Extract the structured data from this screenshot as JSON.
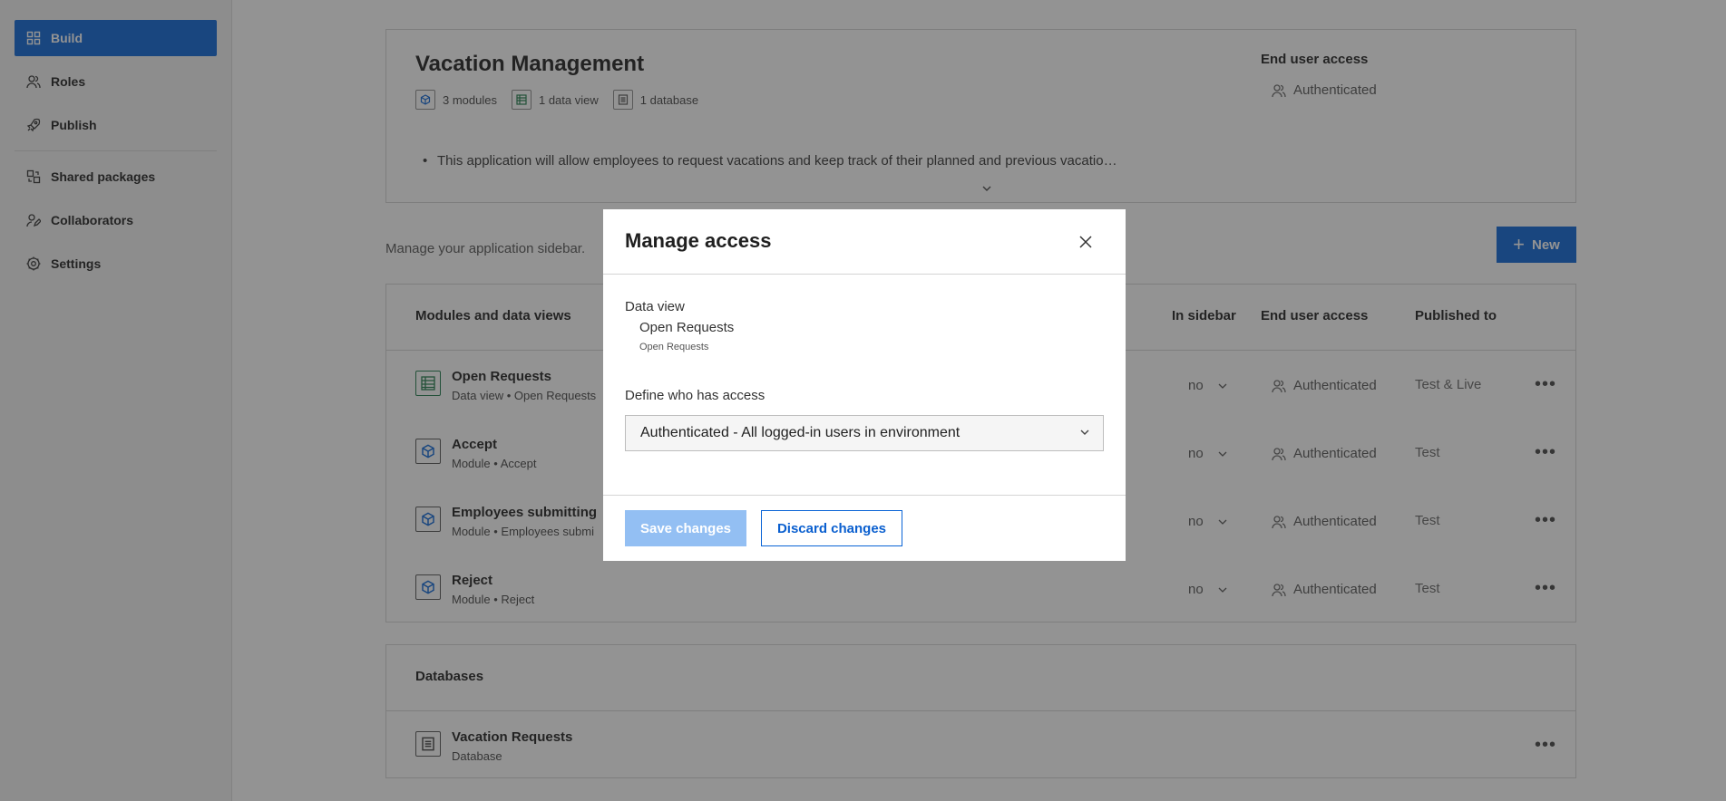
{
  "nav": {
    "items": [
      {
        "label": "Build",
        "icon": "grid-icon"
      },
      {
        "label": "Roles",
        "icon": "users-icon"
      },
      {
        "label": "Publish",
        "icon": "rocket-icon"
      },
      {
        "label": "Shared packages",
        "icon": "packages-icon"
      },
      {
        "label": "Collaborators",
        "icon": "pen-user-icon"
      },
      {
        "label": "Settings",
        "icon": "gear-icon"
      }
    ],
    "active_color": "#0a64d6"
  },
  "app": {
    "title": "Vacation Management",
    "stats": {
      "modules": "3 modules",
      "data_views": "1 data view",
      "databases": "1 database"
    },
    "end_user_access_label": "End user access",
    "end_user_access_value": "Authenticated",
    "description": "This application will allow employees to request vacations and keep track of their planned and previous vacatio…"
  },
  "sidebar_section": {
    "description": "Manage your application sidebar.",
    "new_label": "New"
  },
  "modules_table": {
    "headers": {
      "name": "Modules and data views",
      "in_sidebar": "In sidebar",
      "end_user_access": "End user access",
      "published_to": "Published to"
    },
    "rows": [
      {
        "title": "Open Requests",
        "sub": "Data view • Open Requests",
        "in_sidebar": "no",
        "access": "Authenticated",
        "published": "Test & Live"
      },
      {
        "title": "Accept",
        "sub": "Module • Accept",
        "in_sidebar": "no",
        "access": "Authenticated",
        "published": "Test"
      },
      {
        "title": "Employees submitting",
        "sub": "Module • Employees submi",
        "in_sidebar": "no",
        "access": "Authenticated",
        "published": "Test"
      },
      {
        "title": "Reject",
        "sub": "Module • Reject",
        "in_sidebar": "no",
        "access": "Authenticated",
        "published": "Test"
      }
    ]
  },
  "databases": {
    "header": "Databases",
    "rows": [
      {
        "title": "Vacation Requests",
        "sub": "Database"
      }
    ]
  },
  "modal": {
    "title": "Manage access",
    "data_view_label": "Data view",
    "data_view_name": "Open Requests",
    "data_view_sub": "Open Requests",
    "define_label": "Define who has access",
    "select_value": "Authenticated - All logged-in users in environment",
    "save_label": "Save changes",
    "discard_label": "Discard changes"
  }
}
